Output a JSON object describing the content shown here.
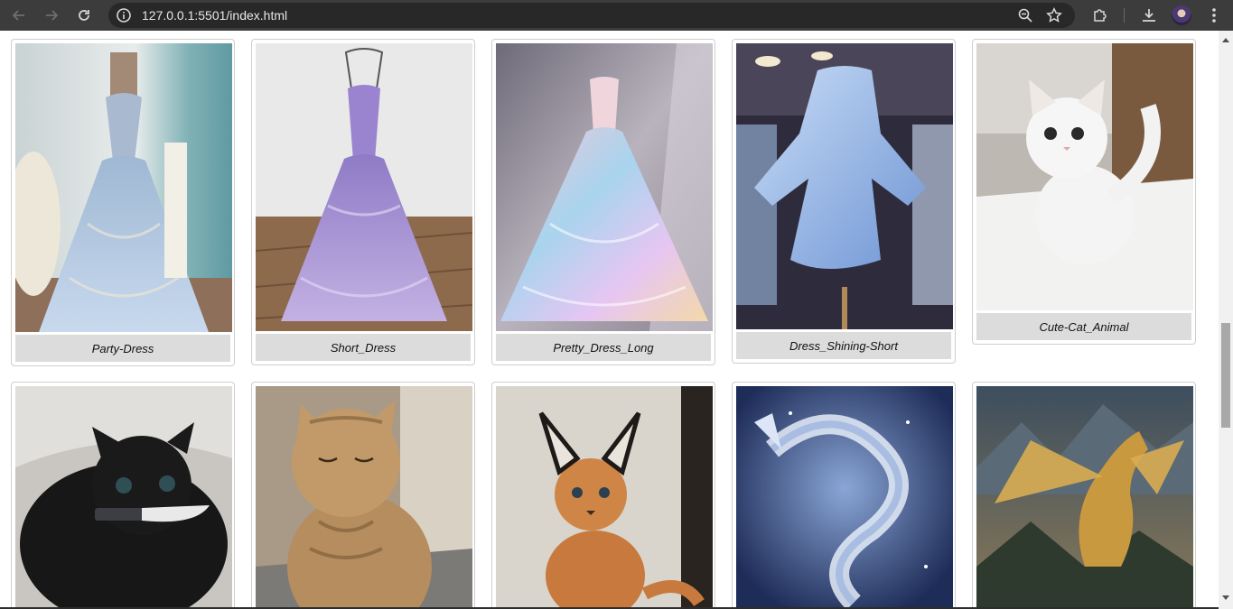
{
  "browser": {
    "url": "127.0.0.1:5501/index.html"
  },
  "gallery": {
    "row1": [
      {
        "caption": "Party-Dress",
        "image": "blue-ball-gown"
      },
      {
        "caption": "Short_Dress",
        "image": "purple-ball-gown"
      },
      {
        "caption": "Pretty_Dress_Long",
        "image": "iridescent-gown"
      },
      {
        "caption": "Dress_Shining-Short",
        "image": "blue-short-dress"
      },
      {
        "caption": "Cute-Cat_Animal",
        "image": "white-kitten"
      }
    ],
    "row2": [
      {
        "image": "black-cat-with-knife"
      },
      {
        "image": "tabby-cat"
      },
      {
        "image": "caracal-kitten"
      },
      {
        "image": "silver-dragon"
      },
      {
        "image": "golden-dragon"
      }
    ]
  },
  "colors": {
    "chrome_bg": "#3c3c3c",
    "omnibox_bg": "#282828",
    "caption_bg": "#dcdcdc"
  }
}
